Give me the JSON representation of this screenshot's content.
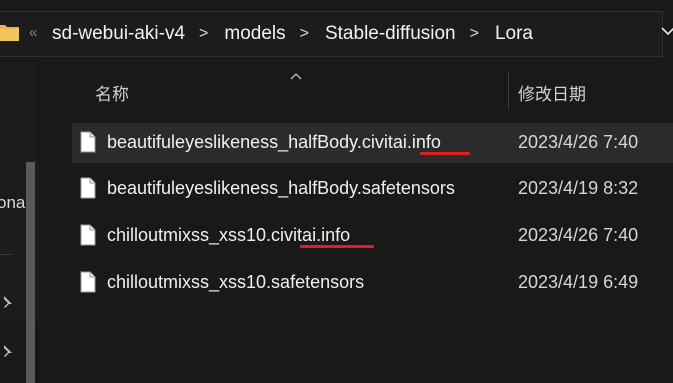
{
  "breadcrumbs": [
    "sd-webui-aki-v4",
    "models",
    "Stable-diffusion",
    "Lora"
  ],
  "overflow_glyph": "«",
  "separator_glyph": ">",
  "nav": {
    "partial_label": "ona"
  },
  "columns": {
    "name": "名称",
    "date": "修改日期"
  },
  "files": [
    {
      "name": "beautifuleyeslikeness_halfBody.civitai.info",
      "date": "2023/4/26 7:40",
      "selected": true
    },
    {
      "name": "beautifuleyeslikeness_halfBody.safetensors",
      "date": "2023/4/19 8:32",
      "selected": false
    },
    {
      "name": "chilloutmixss_xss10.civitai.info",
      "date": "2023/4/26 7:40",
      "selected": false
    },
    {
      "name": "chilloutmixss_xss10.safetensors",
      "date": "2023/4/19 6:49",
      "selected": false
    }
  ],
  "colors": {
    "annotation_underline": "#e02020",
    "folder": "#e8b34a",
    "background": "#191919"
  }
}
